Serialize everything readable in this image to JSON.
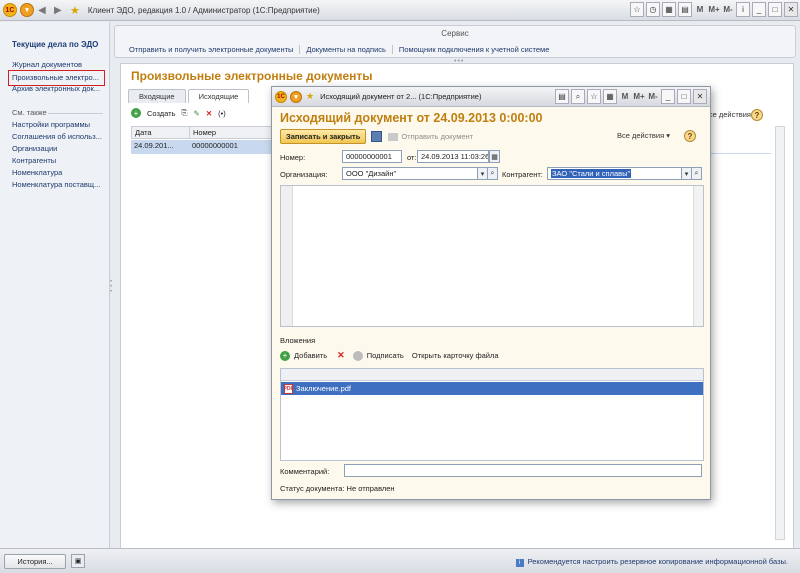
{
  "app": {
    "title": "Клиент ЭДО, редакция 1.0 / Администратор  (1С:Предприятие)",
    "logo": "1С"
  },
  "sidebar": {
    "title": "Текущие дела по ЭДО",
    "items": [
      {
        "label": "Журнал документов"
      },
      {
        "label": "Произвольные электро..."
      },
      {
        "label": "Архив электронных док..."
      }
    ],
    "see_also_title": "См. также",
    "see_also": [
      {
        "label": "Настройки программы"
      },
      {
        "label": "Соглашения об использ..."
      },
      {
        "label": "Организации"
      },
      {
        "label": "Контрагенты"
      },
      {
        "label": "Номенклатура"
      },
      {
        "label": "Номенклатура поставщ..."
      }
    ]
  },
  "service": {
    "title": "Сервис",
    "links": [
      {
        "label": "Отправить и получить электронные документы"
      },
      {
        "label": "Документы на подпись"
      },
      {
        "label": "Помощник подключения к учетной системе"
      }
    ]
  },
  "bg_form": {
    "title": "Произвольные электронные документы",
    "tabs": [
      {
        "label": "Входящие"
      },
      {
        "label": "Исходящие"
      }
    ],
    "create_label": "Создать",
    "all_actions_label": "Все действия",
    "col_date": "Дата",
    "col_number": "Номер",
    "row_date": "24.09.201...",
    "row_number": "00000000001"
  },
  "modal": {
    "window_title": "Исходящий документ  от 2...  (1С:Предприятие)",
    "heading": "Исходящий документ  от 24.09.2013 0:00:00",
    "save_close_label": "Записать и закрыть",
    "send_label": "Отправить документ",
    "all_actions_label": "Все действия",
    "number_label": "Номер:",
    "number_value": "00000000001",
    "date_label": "от:",
    "date_value": "24.09.2013 11:03:26",
    "org_label": "Организация:",
    "org_value": "ООО \"Дизайн\"",
    "counterparty_label": "Контрагент:",
    "counterparty_value": "ЗАО \"Стали и сплавы\"",
    "attachments_title": "Вложения",
    "add_label": "Добавить",
    "sign_label": "Подписать",
    "open_card_label": "Открыть карточку файла",
    "attachment_file": "Заключение.pdf",
    "comment_label": "Комментарий:",
    "comment_value": "",
    "status_label": "Статус документа:",
    "status_value": "Не отправлен"
  },
  "statusbar": {
    "history_label": "История...",
    "message": "Рекомендуется настроить резервное копирование информационной базы."
  }
}
